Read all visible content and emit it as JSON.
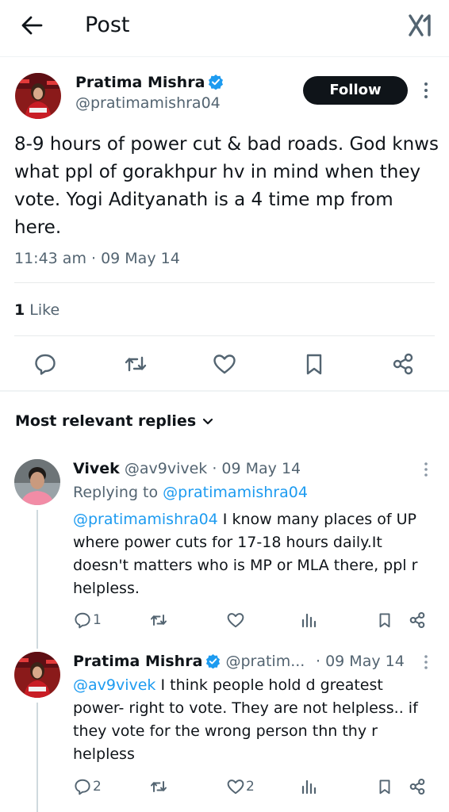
{
  "header": {
    "title": "Post",
    "back_icon": "arrow-left-icon",
    "logo": "x-logo"
  },
  "post": {
    "author_name": "Pratima Mishra",
    "author_handle": "@pratimamishra04",
    "follow_label": "Follow",
    "text": "8-9 hours of power cut & bad roads. God knws what ppl of gorakhpur hv in mind when they vote. Yogi Adityanath is a 4 time mp from here.",
    "timestamp": "11:43 am · 09 May 14",
    "like_count": "1",
    "like_label": "Like",
    "actions": [
      "reply-icon",
      "retweet-icon",
      "heart-icon",
      "bookmark-icon",
      "share-icon"
    ]
  },
  "replies_header": {
    "label": "Most relevant replies"
  },
  "replies": [
    {
      "name": "Vivek",
      "handle": "@av9vivek",
      "date": "· 09 May 14",
      "replying_prefix": "Replying to",
      "replying_to": "@pratimamishra04",
      "mention": "@pratimamishra04",
      "text": " I know many places of UP where power cuts for 17-18 hours daily.It doesn't matters who is MP or MLA there, ppl r helpless.",
      "reply_count": "1",
      "retweet_count": "",
      "like_count": "",
      "views_count": ""
    },
    {
      "name": "Pratima Mishra",
      "handle": "@pratim...",
      "date": "· 09 May 14",
      "mention": "@av9vivek",
      "text": " I think people hold d greatest power- right to vote. They are not helpless.. if they vote for the wrong person thn thy r helpless",
      "reply_count": "2",
      "retweet_count": "",
      "like_count": "2",
      "views_count": ""
    }
  ],
  "colors": {
    "text": "#0f1419",
    "secondary": "#536471",
    "link": "#1d9bf0",
    "verified": "#1d9bf0",
    "follow_bg": "#0f1419"
  }
}
